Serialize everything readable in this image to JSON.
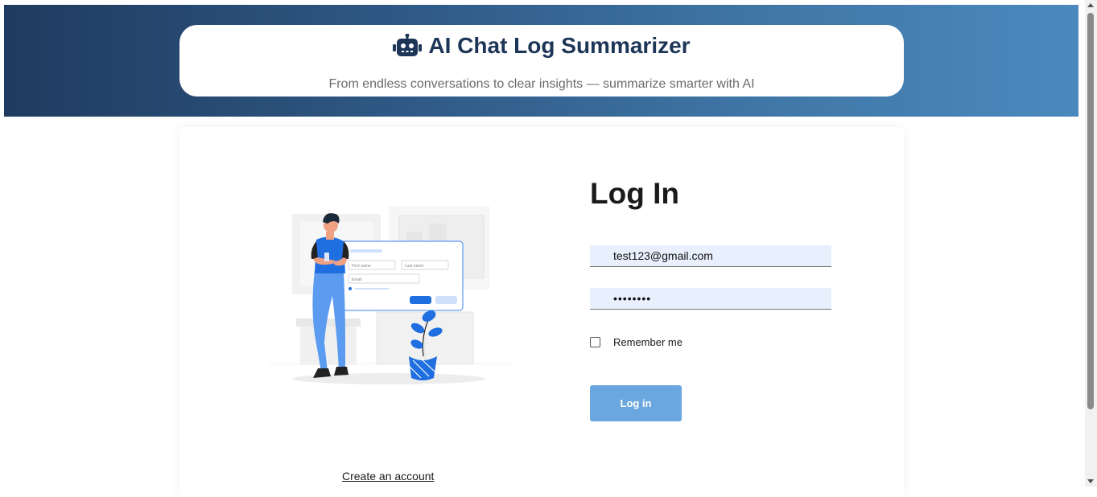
{
  "header": {
    "title": "AI Chat Log Summarizer",
    "subtitle": "From endless conversations to clear insights — summarize smarter with AI",
    "icon": "robot-icon",
    "gradient_start": "#1f3b5f",
    "gradient_end": "#4b89bd",
    "title_color": "#1d3557"
  },
  "login": {
    "title": "Log In",
    "email_value": "test123@gmail.com",
    "password_value": "••••••••",
    "remember_label": "Remember me",
    "remember_checked": false,
    "button_label": "Log in",
    "button_color": "#6aa7de",
    "create_account_label": "Create an account"
  },
  "illustration": {
    "first_name_label": "First name",
    "last_name_label": "Last name",
    "email_label": "Email"
  }
}
